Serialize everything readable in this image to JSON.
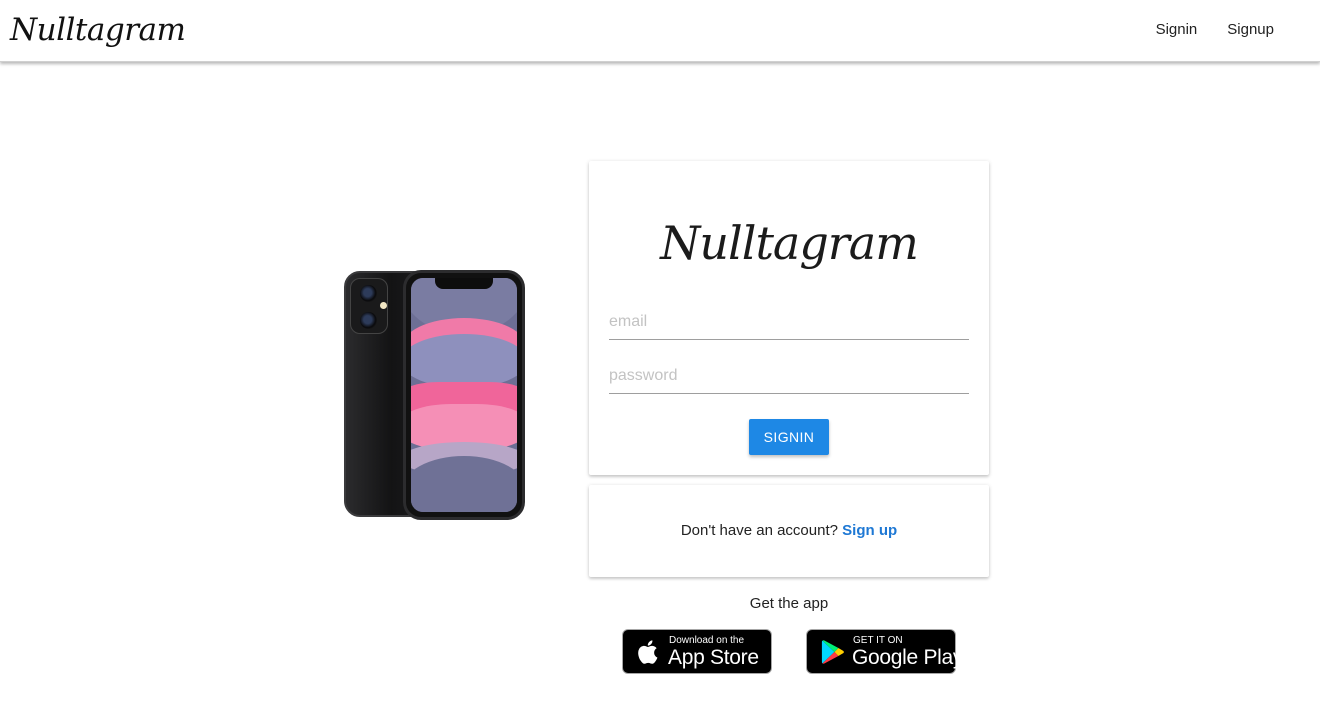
{
  "navbar": {
    "brand": "Nulltagram",
    "links": {
      "signin": "Signin",
      "signup": "Signup"
    }
  },
  "login_card": {
    "brand": "Nulltagram",
    "email_placeholder": "email",
    "password_placeholder": "password",
    "signin_label": "SIGNIN",
    "accent": "#1e88e5"
  },
  "signup_card": {
    "prompt": "Don't have an account?",
    "link": "Sign up"
  },
  "get_app": {
    "label": "Get the app",
    "app_store": {
      "small": "Download on the",
      "big": "App Store",
      "icon": "apple-icon"
    },
    "google_play": {
      "small": "GET IT ON",
      "big": "Google Play",
      "icon": "google-play-icon"
    }
  }
}
